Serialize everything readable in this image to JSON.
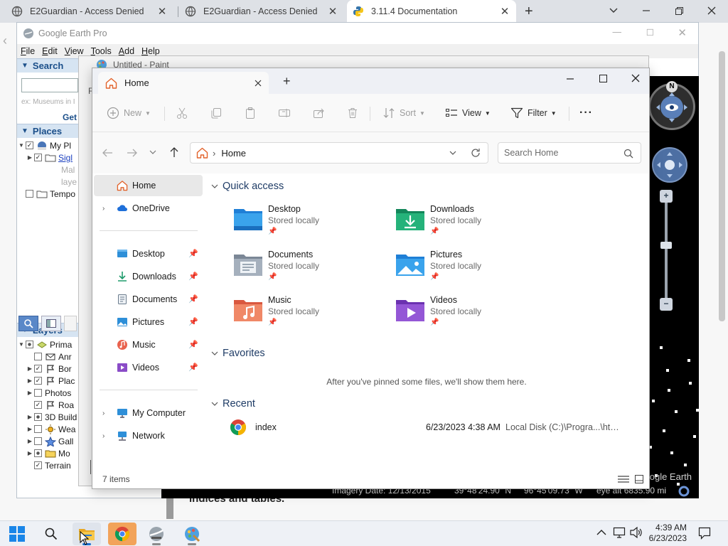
{
  "browser": {
    "tabs": [
      {
        "title": "E2Guardian - Access Denied",
        "icon": "shield-globe-icon"
      },
      {
        "title": "E2Guardian - Access Denied",
        "icon": "shield-globe-icon"
      },
      {
        "title": "3.11.4 Documentation",
        "icon": "python-icon"
      }
    ],
    "new_tab": "+",
    "close": "✕"
  },
  "google_earth": {
    "title": "Google Earth Pro",
    "menu": [
      "File",
      "Edit",
      "View",
      "Tools",
      "Add",
      "Help"
    ],
    "search": {
      "header": "Search",
      "hint": "ex: Museums in I",
      "get": "Get"
    },
    "places": {
      "header": "Places",
      "items": [
        {
          "label": "My Pl",
          "checked": true
        },
        {
          "label": "Sigl",
          "checked": true
        },
        {
          "label": "Mal"
        },
        {
          "label": "laye"
        },
        {
          "label": "Tempo",
          "checked": false
        }
      ]
    },
    "layers": {
      "header": "Layers",
      "items": [
        {
          "label": "Prima",
          "state": "partial",
          "expand": "▼",
          "icon": "globe-layers-icon"
        },
        {
          "label": "Anr",
          "state": "off",
          "expand": "",
          "icon": "mail-icon"
        },
        {
          "label": "Bor",
          "state": "on",
          "expand": "▶",
          "icon": "flag-icon"
        },
        {
          "label": "Plac",
          "state": "on",
          "expand": "▶",
          "icon": "flag-icon"
        },
        {
          "label": "Photos",
          "state": "off",
          "expand": "▶",
          "icon": ""
        },
        {
          "label": "Roa",
          "state": "on",
          "expand": "",
          "icon": "road-icon"
        },
        {
          "label": "3D Build",
          "state": "partial",
          "expand": "▶",
          "icon": ""
        },
        {
          "label": "Wea",
          "state": "off",
          "expand": "▶",
          "icon": "sun-icon"
        },
        {
          "label": "Gall",
          "state": "off",
          "expand": "▶",
          "icon": "star-icon"
        },
        {
          "label": "Mo",
          "state": "partial",
          "expand": "▶",
          "icon": "folder-icon"
        },
        {
          "label": "Terrain",
          "state": "on",
          "expand": "",
          "icon": ""
        }
      ]
    },
    "status": {
      "imagery_date": "Imagery Date: 12/13/2015",
      "lat": "39°48'24.90\" N",
      "lon": "96°45'09.73\" W",
      "eye_alt": "eye alt 6835.90 mi",
      "watermark": "Google Earth"
    }
  },
  "paint": {
    "title": "Untitled - Paint"
  },
  "behind_text": "indices and tables.",
  "explorer": {
    "tab_title": "Home",
    "toolbar": {
      "new": "New",
      "sort": "Sort",
      "view": "View",
      "filter": "Filter",
      "more": "···"
    },
    "address": {
      "location": "Home",
      "separator": "›"
    },
    "search_placeholder": "Search Home",
    "nav": {
      "home": "Home",
      "onedrive": "OneDrive",
      "pinned": [
        "Desktop",
        "Downloads",
        "Documents",
        "Pictures",
        "Music",
        "Videos"
      ],
      "my_computer": "My Computer",
      "network": "Network"
    },
    "quick_access": {
      "header": "Quick access",
      "items": [
        {
          "name": "Desktop",
          "sub": "Stored locally"
        },
        {
          "name": "Downloads",
          "sub": "Stored locally"
        },
        {
          "name": "Documents",
          "sub": "Stored locally"
        },
        {
          "name": "Pictures",
          "sub": "Stored locally"
        },
        {
          "name": "Music",
          "sub": "Stored locally"
        },
        {
          "name": "Videos",
          "sub": "Stored locally"
        }
      ]
    },
    "favorites": {
      "header": "Favorites",
      "empty_text": "After you've pinned some files, we'll show them here."
    },
    "recent": {
      "header": "Recent",
      "items": [
        {
          "name": "index",
          "date": "6/23/2023 4:38 AM",
          "location": "Local Disk (C:)\\Progra...\\html"
        }
      ]
    },
    "status": "7 items"
  },
  "taskbar": {
    "time": "4:39 AM",
    "date": "6/23/2023"
  }
}
